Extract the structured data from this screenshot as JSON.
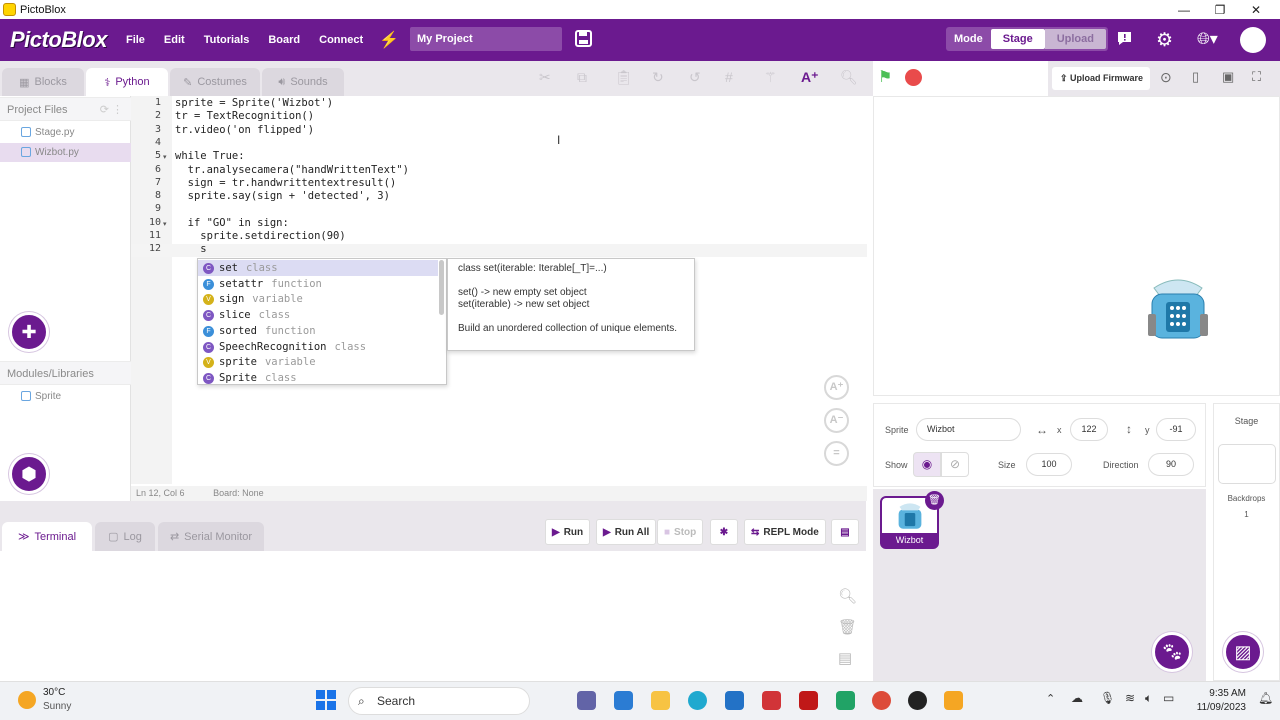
{
  "window": {
    "title": "PictoBlox"
  },
  "menubar": {
    "logo": "PictoBlox",
    "items": [
      "File",
      "Edit",
      "Tutorials",
      "Board",
      "Connect"
    ],
    "project_name": "My Project",
    "mode_label": "Mode",
    "mode_stage": "Stage",
    "mode_upload": "Upload"
  },
  "tabs": {
    "blocks": "Blocks",
    "python": "Python",
    "costumes": "Costumes",
    "sounds": "Sounds"
  },
  "right_toolbar": {
    "upload_firmware": "Upload Firmware"
  },
  "file_pane": {
    "header": "Project Files",
    "files": [
      "Stage.py",
      "Wizbot.py"
    ],
    "modules_header": "Modules/Libraries",
    "modules": [
      "Sprite"
    ]
  },
  "code": {
    "line_numbers": [
      "1",
      "2",
      "3",
      "4",
      "5",
      "6",
      "7",
      "8",
      "9",
      "10",
      "11",
      "12"
    ],
    "lines": [
      "sprite = Sprite('Wizbot')",
      "tr = TextRecognition()",
      "tr.video('on flipped')",
      "",
      "while True:",
      "  tr.analysecamera(\"handWrittenText\")",
      "  sign = tr.handwrittentextresult()",
      "  sprite.say(sign + 'detected', 3)",
      "",
      "  if \"GO\" in sign:",
      "    sprite.setdirection(90)",
      "    s"
    ]
  },
  "autocomplete": {
    "items": [
      {
        "name": "set",
        "kind": "class",
        "badge": "C"
      },
      {
        "name": "setattr",
        "kind": "function",
        "badge": "F"
      },
      {
        "name": "sign",
        "kind": "variable",
        "badge": "V"
      },
      {
        "name": "slice",
        "kind": "class",
        "badge": "C"
      },
      {
        "name": "sorted",
        "kind": "function",
        "badge": "F"
      },
      {
        "name": "SpeechRecognition",
        "kind": "class",
        "badge": "C"
      },
      {
        "name": "sprite",
        "kind": "variable",
        "badge": "V"
      },
      {
        "name": "Sprite",
        "kind": "class",
        "badge": "C"
      }
    ],
    "doc": {
      "signature": "class set(iterable: Iterable[_T]=...)",
      "line1": "set() -> new empty set object",
      "line2": "set(iterable) -> new set object",
      "desc": "Build an unordered collection of unique elements."
    }
  },
  "editor_status": {
    "position": "Ln 12, Col 6",
    "board": "Board: None"
  },
  "terminal": {
    "tabs": [
      "Terminal",
      "Log",
      "Serial Monitor"
    ],
    "run": "Run",
    "run_all": "Run All",
    "stop": "Stop",
    "repl": "REPL Mode"
  },
  "sprite_info": {
    "sprite_label": "Sprite",
    "sprite_name": "Wizbot",
    "x_label": "x",
    "x": "122",
    "y_label": "y",
    "y": "-91",
    "show_label": "Show",
    "size_label": "Size",
    "size": "100",
    "direction_label": "Direction",
    "direction": "90"
  },
  "sprite_list": {
    "items": [
      "Wizbot"
    ]
  },
  "stage_col": {
    "label": "Stage",
    "backdrops_label": "Backdrops",
    "backdrops_count": "1"
  },
  "taskbar": {
    "weather_temp": "30°C",
    "weather_desc": "Sunny",
    "search": "Search",
    "time": "9:35 AM",
    "date": "11/09/2023"
  },
  "colors": {
    "brand": "#6b1a8f",
    "accent_green": "#4cbf56",
    "stop_red": "#e94b4b"
  }
}
